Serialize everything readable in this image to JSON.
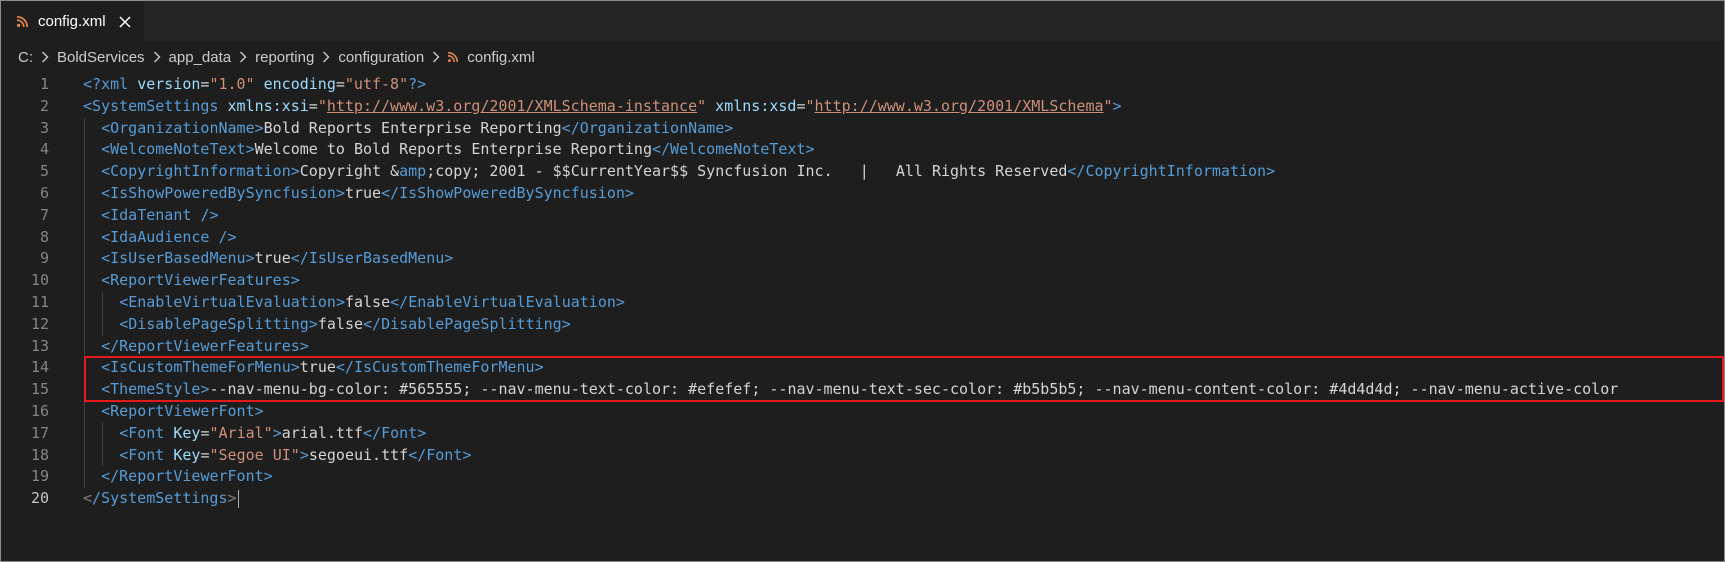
{
  "tab": {
    "label": "config.xml",
    "close": "✕"
  },
  "breadcrumb": [
    "C:",
    "BoldServices",
    "app_data",
    "reporting",
    "configuration",
    "config.xml"
  ],
  "colors": {
    "accent_box": "#e51b1b",
    "rss": "#e8894a"
  },
  "lines": [
    {
      "n": "1",
      "indent": 0,
      "tokens": [
        [
          "pi",
          "<?"
        ],
        [
          "tname",
          "xml "
        ],
        [
          "attr",
          "version"
        ],
        [
          "txt",
          "="
        ],
        [
          "str",
          "\"1.0\""
        ],
        [
          "txt",
          " "
        ],
        [
          "attr",
          "encoding"
        ],
        [
          "txt",
          "="
        ],
        [
          "str",
          "\"utf-8\""
        ],
        [
          "pi",
          "?>"
        ]
      ]
    },
    {
      "n": "2",
      "indent": 0,
      "tokens": [
        [
          "tag",
          "<"
        ],
        [
          "tname",
          "SystemSettings "
        ],
        [
          "attr",
          "xmlns:xsi"
        ],
        [
          "txt",
          "="
        ],
        [
          "str",
          "\""
        ],
        [
          "url",
          "http://www.w3.org/2001/XMLSchema-instance"
        ],
        [
          "str",
          "\""
        ],
        [
          "txt",
          " "
        ],
        [
          "attr",
          "xmlns:xsd"
        ],
        [
          "txt",
          "="
        ],
        [
          "str",
          "\""
        ],
        [
          "url",
          "http://www.w3.org/2001/XMLSchema"
        ],
        [
          "str",
          "\""
        ],
        [
          "tag",
          ">"
        ]
      ]
    },
    {
      "n": "3",
      "indent": 1,
      "tokens": [
        [
          "tag",
          "<"
        ],
        [
          "tname",
          "OrganizationName"
        ],
        [
          "tag",
          ">"
        ],
        [
          "txt",
          "Bold Reports Enterprise Reporting"
        ],
        [
          "tag",
          "</"
        ],
        [
          "tname",
          "OrganizationName"
        ],
        [
          "tag",
          ">"
        ]
      ]
    },
    {
      "n": "4",
      "indent": 1,
      "tokens": [
        [
          "tag",
          "<"
        ],
        [
          "tname",
          "WelcomeNoteText"
        ],
        [
          "tag",
          ">"
        ],
        [
          "txt",
          "Welcome to Bold Reports Enterprise Reporting"
        ],
        [
          "tag",
          "</"
        ],
        [
          "tname",
          "WelcomeNoteText"
        ],
        [
          "tag",
          ">"
        ]
      ]
    },
    {
      "n": "5",
      "indent": 1,
      "tokens": [
        [
          "tag",
          "<"
        ],
        [
          "tname",
          "CopyrightInformation"
        ],
        [
          "tag",
          ">"
        ],
        [
          "txt",
          "Copyright &"
        ],
        [
          "tname",
          "amp"
        ],
        [
          "txt",
          ";copy; 2001 - $$CurrentYear$$ Syncfusion Inc.   |   All Rights Reserved"
        ],
        [
          "tag",
          "</"
        ],
        [
          "tname",
          "CopyrightInformation"
        ],
        [
          "tag",
          ">"
        ]
      ]
    },
    {
      "n": "6",
      "indent": 1,
      "tokens": [
        [
          "tag",
          "<"
        ],
        [
          "tname",
          "IsShowPoweredBySyncfusion"
        ],
        [
          "tag",
          ">"
        ],
        [
          "txt",
          "true"
        ],
        [
          "tag",
          "</"
        ],
        [
          "tname",
          "IsShowPoweredBySyncfusion"
        ],
        [
          "tag",
          ">"
        ]
      ]
    },
    {
      "n": "7",
      "indent": 1,
      "tokens": [
        [
          "tag",
          "<"
        ],
        [
          "tname",
          "IdaTenant "
        ],
        [
          "tag",
          "/>"
        ]
      ]
    },
    {
      "n": "8",
      "indent": 1,
      "tokens": [
        [
          "tag",
          "<"
        ],
        [
          "tname",
          "IdaAudience "
        ],
        [
          "tag",
          "/>"
        ]
      ]
    },
    {
      "n": "9",
      "indent": 1,
      "tokens": [
        [
          "tag",
          "<"
        ],
        [
          "tname",
          "IsUserBasedMenu"
        ],
        [
          "tag",
          ">"
        ],
        [
          "txt",
          "true"
        ],
        [
          "tag",
          "</"
        ],
        [
          "tname",
          "IsUserBasedMenu"
        ],
        [
          "tag",
          ">"
        ]
      ]
    },
    {
      "n": "10",
      "indent": 1,
      "tokens": [
        [
          "tag",
          "<"
        ],
        [
          "tname",
          "ReportViewerFeatures"
        ],
        [
          "tag",
          ">"
        ]
      ]
    },
    {
      "n": "11",
      "indent": 2,
      "tokens": [
        [
          "tag",
          "<"
        ],
        [
          "tname",
          "EnableVirtualEvaluation"
        ],
        [
          "tag",
          ">"
        ],
        [
          "txt",
          "false"
        ],
        [
          "tag",
          "</"
        ],
        [
          "tname",
          "EnableVirtualEvaluation"
        ],
        [
          "tag",
          ">"
        ]
      ]
    },
    {
      "n": "12",
      "indent": 2,
      "tokens": [
        [
          "tag",
          "<"
        ],
        [
          "tname",
          "DisablePageSplitting"
        ],
        [
          "tag",
          ">"
        ],
        [
          "txt",
          "false"
        ],
        [
          "tag",
          "</"
        ],
        [
          "tname",
          "DisablePageSplitting"
        ],
        [
          "tag",
          ">"
        ]
      ]
    },
    {
      "n": "13",
      "indent": 1,
      "tokens": [
        [
          "tag",
          "</"
        ],
        [
          "tname",
          "ReportViewerFeatures"
        ],
        [
          "tag",
          ">"
        ]
      ]
    },
    {
      "n": "14",
      "indent": 1,
      "tokens": [
        [
          "tag",
          "<"
        ],
        [
          "tname",
          "IsCustomThemeForMenu"
        ],
        [
          "tag",
          ">"
        ],
        [
          "txt",
          "true"
        ],
        [
          "tag",
          "</"
        ],
        [
          "tname",
          "IsCustomThemeForMenu"
        ],
        [
          "tag",
          ">"
        ]
      ]
    },
    {
      "n": "15",
      "indent": 1,
      "tokens": [
        [
          "tag",
          "<"
        ],
        [
          "tname",
          "ThemeStyle"
        ],
        [
          "tag",
          ">"
        ],
        [
          "txt",
          "--nav-menu-bg-color: #565555; --nav-menu-text-color: #efefef; --nav-menu-text-sec-color: #b5b5b5; --nav-menu-content-color: #4d4d4d; --nav-menu-active-color"
        ]
      ]
    },
    {
      "n": "16",
      "indent": 1,
      "tokens": [
        [
          "tag",
          "<"
        ],
        [
          "tname",
          "ReportViewerFont"
        ],
        [
          "tag",
          ">"
        ]
      ]
    },
    {
      "n": "17",
      "indent": 2,
      "tokens": [
        [
          "tag",
          "<"
        ],
        [
          "tname",
          "Font "
        ],
        [
          "attr",
          "Key"
        ],
        [
          "txt",
          "="
        ],
        [
          "str",
          "\"Arial\""
        ],
        [
          "tag",
          ">"
        ],
        [
          "txt",
          "arial.ttf"
        ],
        [
          "tag",
          "</"
        ],
        [
          "tname",
          "Font"
        ],
        [
          "tag",
          ">"
        ]
      ]
    },
    {
      "n": "18",
      "indent": 2,
      "tokens": [
        [
          "tag",
          "<"
        ],
        [
          "tname",
          "Font "
        ],
        [
          "attr",
          "Key"
        ],
        [
          "txt",
          "="
        ],
        [
          "str",
          "\"Segoe UI\""
        ],
        [
          "tag",
          ">"
        ],
        [
          "txt",
          "segoeui.ttf"
        ],
        [
          "tag",
          "</"
        ],
        [
          "tname",
          "Font"
        ],
        [
          "tag",
          ">"
        ]
      ]
    },
    {
      "n": "19",
      "indent": 1,
      "tokens": [
        [
          "tag",
          "</"
        ],
        [
          "tname",
          "ReportViewerFont"
        ],
        [
          "tag",
          ">"
        ]
      ]
    },
    {
      "n": "20",
      "indent": 0,
      "tokens": [
        [
          "pun",
          "<"
        ],
        [
          "tag",
          "/"
        ],
        [
          "tname",
          "SystemSettings"
        ],
        [
          "pun",
          ">"
        ]
      ]
    }
  ]
}
